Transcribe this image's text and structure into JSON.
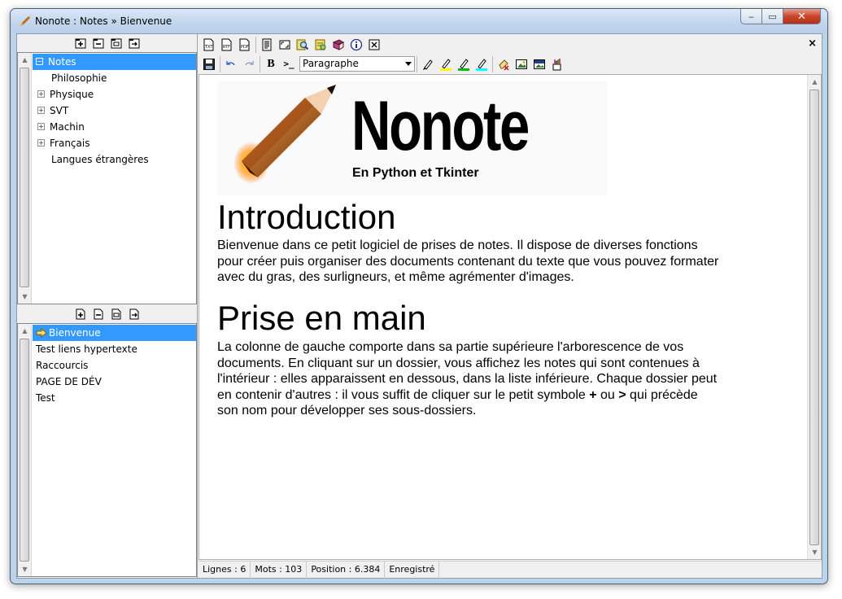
{
  "window": {
    "title": "Nonote : Notes » Bienvenue",
    "minimize_label": "‒",
    "maximize_label": "▭",
    "close_label": "✕"
  },
  "folders": [
    {
      "label": "Notes",
      "expander": "⊟",
      "selected": true,
      "indent": 0
    },
    {
      "label": "Philosophie",
      "expander": "",
      "selected": false,
      "indent": 1
    },
    {
      "label": "Physique",
      "expander": "+",
      "selected": false,
      "indent": 1
    },
    {
      "label": "SVT",
      "expander": "+",
      "selected": false,
      "indent": 1
    },
    {
      "label": "Machin",
      "expander": "+",
      "selected": false,
      "indent": 1
    },
    {
      "label": "Français",
      "expander": "+",
      "selected": false,
      "indent": 1
    },
    {
      "label": "Langues étrangères",
      "expander": "",
      "selected": false,
      "indent": 1
    }
  ],
  "notes": [
    {
      "label": "Bienvenue",
      "selected": true
    },
    {
      "label": "Test liens hypertexte",
      "selected": false
    },
    {
      "label": "Raccourcis",
      "selected": false
    },
    {
      "label": "PAGE DE DÉV",
      "selected": false
    },
    {
      "label": "Test",
      "selected": false
    }
  ],
  "toolbar": {
    "style_select_value": "Paragraphe",
    "bold_label": "B",
    "code_label": ">_",
    "close_tab_label": "×"
  },
  "document": {
    "logo_title": "Nonote",
    "logo_subtitle": "En Python et Tkinter",
    "section1_heading": "Introduction",
    "section1_text": "Bienvenue dans ce petit logiciel de prises de notes. Il dispose de diverses fonctions pour créer puis organiser des documents contenant du texte que vous pouvez formater avec du gras, des surligneurs, et même agrémenter d'images.",
    "section2_heading": "Prise en main",
    "section2_text_a": "La colonne de gauche comporte dans sa partie supérieure l'arborescence de vos documents. En cliquant sur un dossier, vous affichez les notes qui sont contenues à l'intérieur : elles apparaissent en dessous, dans la liste inférieure. Chaque dossier peut en contenir d'autres : il vous suffit de cliquer sur le petit symbole ",
    "section2_plus": "+",
    "section2_or": " ou ",
    "section2_gt": ">",
    "section2_text_b": " qui précède son nom pour développer ses sous-dossiers."
  },
  "status": {
    "lines": "Lignes : 6",
    "words": "Mots : 103",
    "position": "Position : 6.384",
    "state": "Enregistré"
  },
  "colors": {
    "selection": "#3399ff",
    "highlight_yellow": "#ffff00",
    "highlight_green": "#00c000",
    "highlight_cyan": "#00ffff"
  }
}
